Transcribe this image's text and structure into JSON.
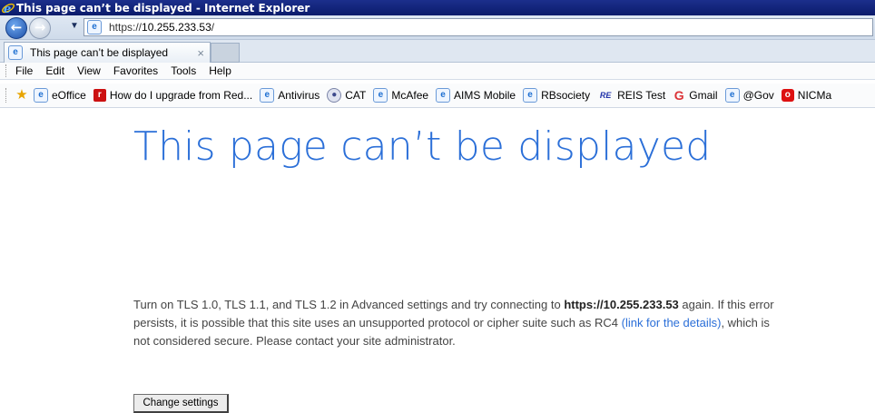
{
  "window": {
    "title": "This page can’t be displayed - Internet Explorer"
  },
  "address_bar": {
    "url_prefix": "https://",
    "url_host": "10.255.233.53",
    "url_suffix": "/"
  },
  "tab": {
    "label": "This page can’t be displayed",
    "close_glyph": "×"
  },
  "menu": {
    "items": [
      "File",
      "Edit",
      "View",
      "Favorites",
      "Tools",
      "Help"
    ]
  },
  "favorites": {
    "items": [
      {
        "label": "eOffice",
        "icon": "ie-icon"
      },
      {
        "label": "How do I upgrade from Red...",
        "icon": "redhat-icon"
      },
      {
        "label": "Antivirus",
        "icon": "ie-icon"
      },
      {
        "label": "CAT",
        "icon": "cat-icon"
      },
      {
        "label": "McAfee",
        "icon": "ie-icon"
      },
      {
        "label": "AIMS Mobile",
        "icon": "ie-icon"
      },
      {
        "label": "RBsociety",
        "icon": "ie-icon"
      },
      {
        "label": "REIS Test",
        "icon": "reis-icon"
      },
      {
        "label": "Gmail",
        "icon": "google-icon"
      },
      {
        "label": "@Gov",
        "icon": "ie-icon"
      },
      {
        "label": "NICMa",
        "icon": "nic-icon"
      }
    ]
  },
  "page": {
    "headline": "This page can’t be displayed",
    "message_part1": "Turn on TLS 1.0, TLS 1.1, and TLS 1.2 in Advanced settings and try connecting to ",
    "message_host": "https://10.255.233.53",
    "message_part2": " again. If this error persists, it is possible that this site uses an unsupported protocol or cipher suite such as RC4 ",
    "message_link": "(link for the details)",
    "message_part3": ", which is not considered secure. Please contact your site administrator.",
    "button_label": "Change settings"
  },
  "colors": {
    "titlebar": "#0b1b6b",
    "headline": "#2b6fd8",
    "link": "#2b6fd8"
  }
}
